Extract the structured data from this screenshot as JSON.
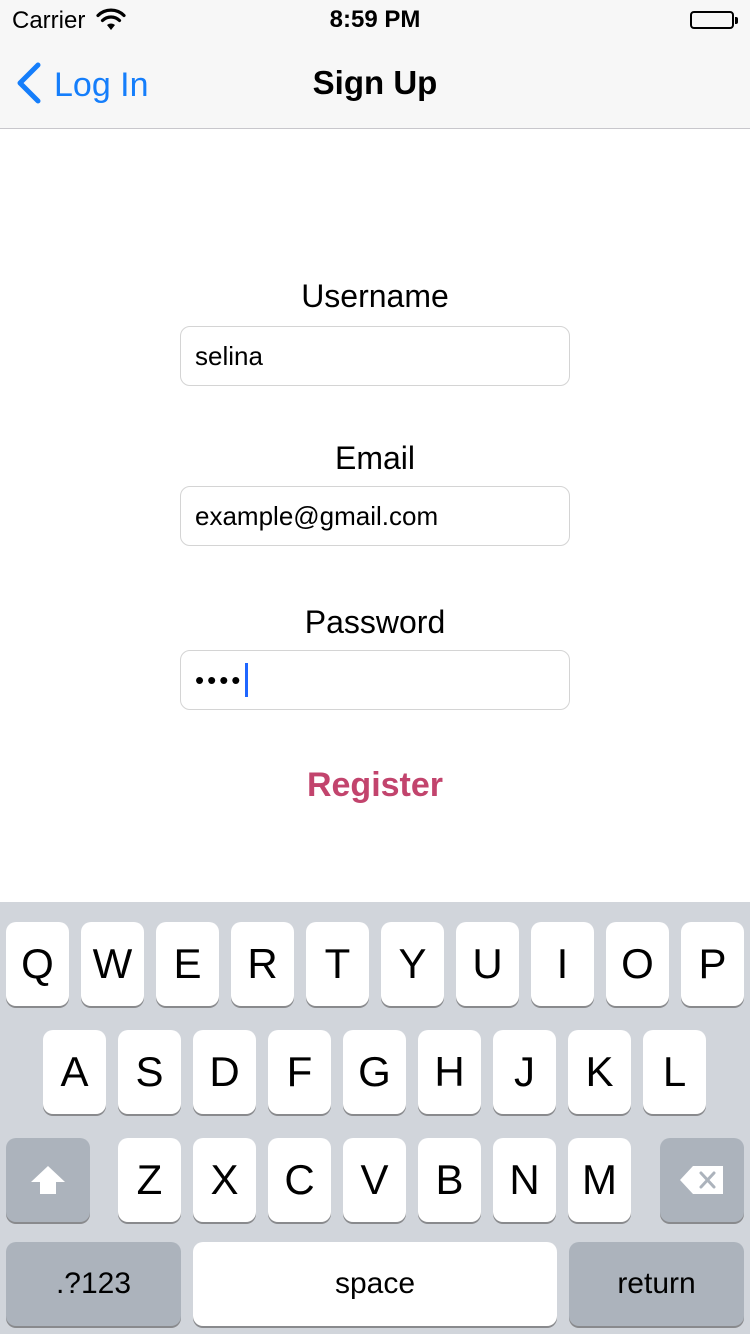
{
  "status": {
    "carrier": "Carrier",
    "time": "8:59 PM"
  },
  "nav": {
    "back_label": "Log In",
    "title": "Sign Up"
  },
  "form": {
    "username_label": "Username",
    "username_value": "selina",
    "email_label": "Email",
    "email_value": "example@gmail.com",
    "password_label": "Password",
    "password_value": "••••",
    "register_label": "Register"
  },
  "keyboard": {
    "row1": [
      "Q",
      "W",
      "E",
      "R",
      "T",
      "Y",
      "U",
      "I",
      "O",
      "P"
    ],
    "row2": [
      "A",
      "S",
      "D",
      "F",
      "G",
      "H",
      "J",
      "K",
      "L"
    ],
    "row3": [
      "Z",
      "X",
      "C",
      "V",
      "B",
      "N",
      "M"
    ],
    "numbers_label": ".?123",
    "space_label": "space",
    "return_label": "return"
  },
  "colors": {
    "accent": "#157efb",
    "register": "#c2446d",
    "keyboard_bg": "#d1d5db"
  }
}
